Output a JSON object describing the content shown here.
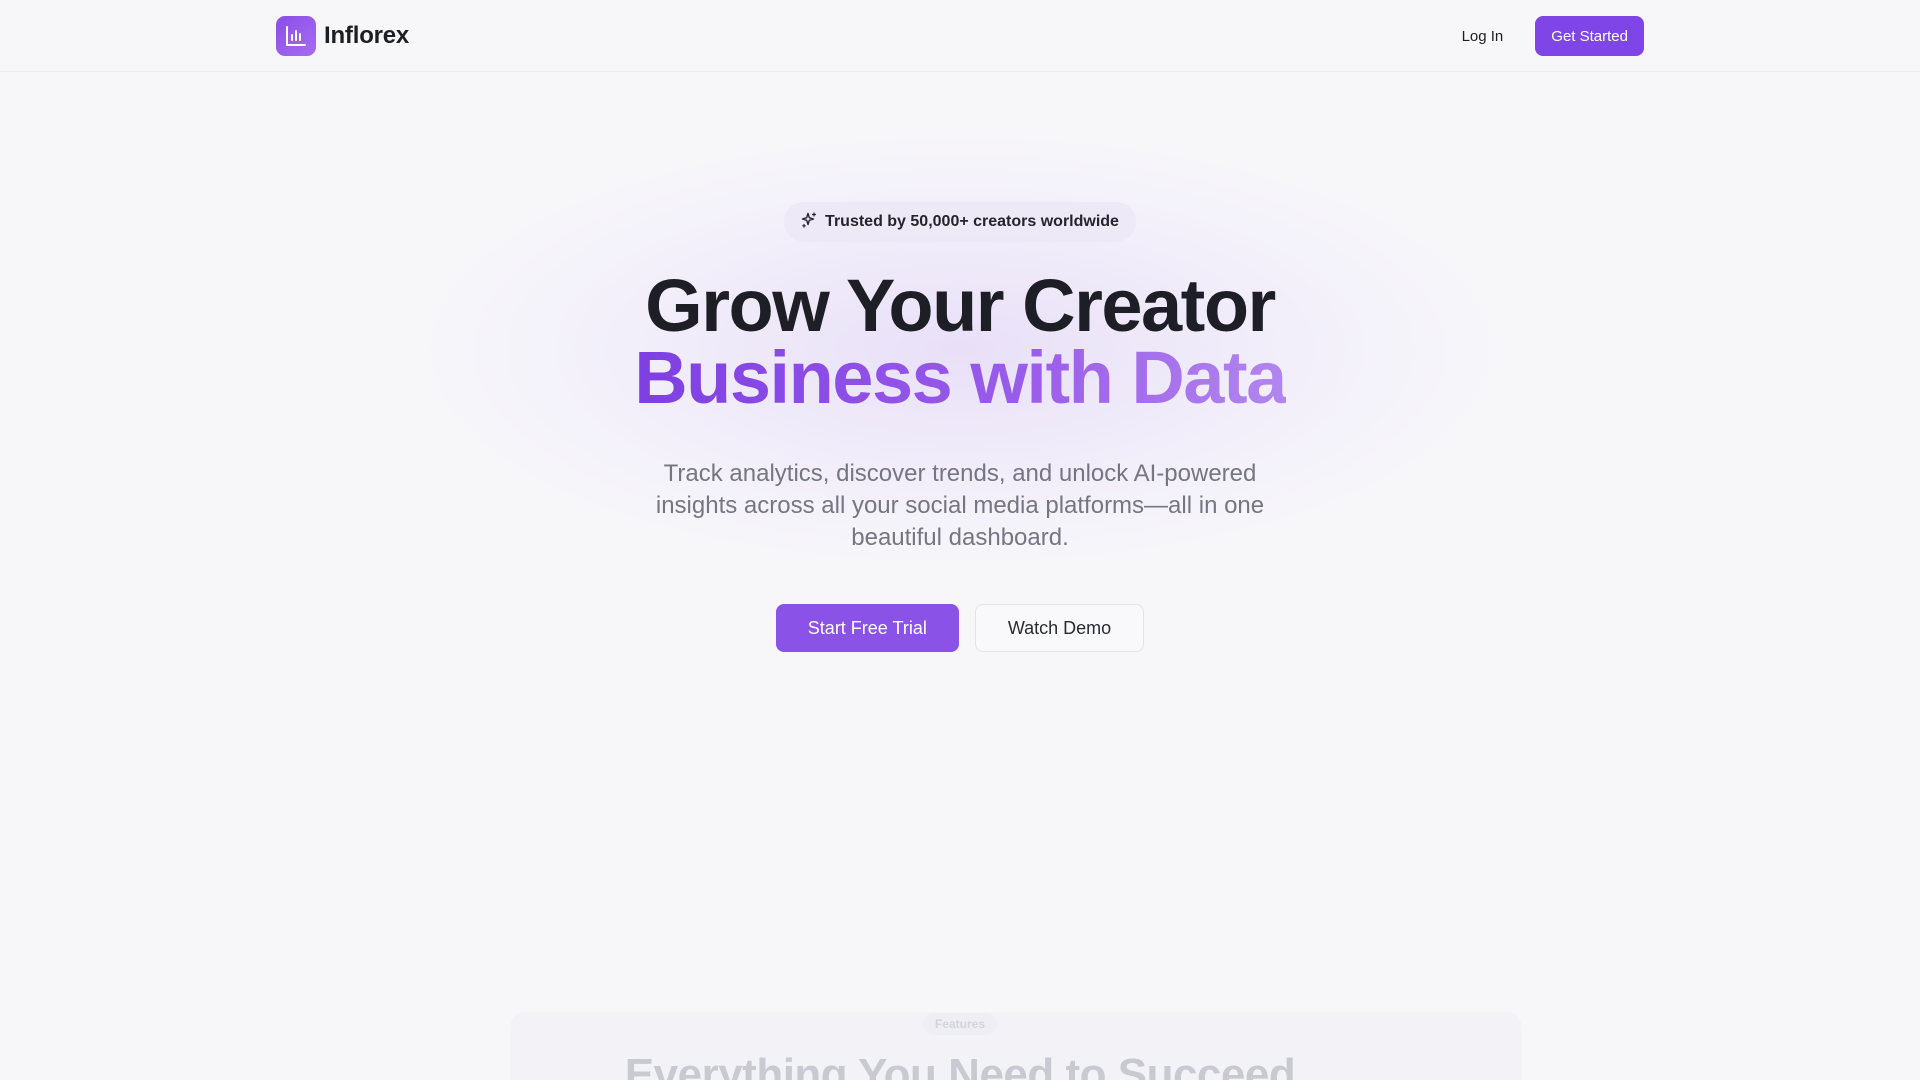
{
  "brand": {
    "name": "Inflorex",
    "logo_icon": "bar-chart-icon",
    "accent_color": "#8b52e8"
  },
  "nav": {
    "login_label": "Log In",
    "get_started_label": "Get Started"
  },
  "hero": {
    "badge_icon": "sparkles-icon",
    "badge_text": "Trusted by 50,000+ creators worldwide",
    "title_line1": "Grow Your Creator",
    "title_line2": "Business with Data",
    "subtitle": "Track analytics, discover trends, and unlock AI-powered insights across all your social media platforms—all in one beautiful dashboard.",
    "primary_cta": "Start Free Trial",
    "secondary_cta": "Watch Demo"
  },
  "features": {
    "tag": "Features",
    "title": "Everything You Need to Succeed"
  }
}
